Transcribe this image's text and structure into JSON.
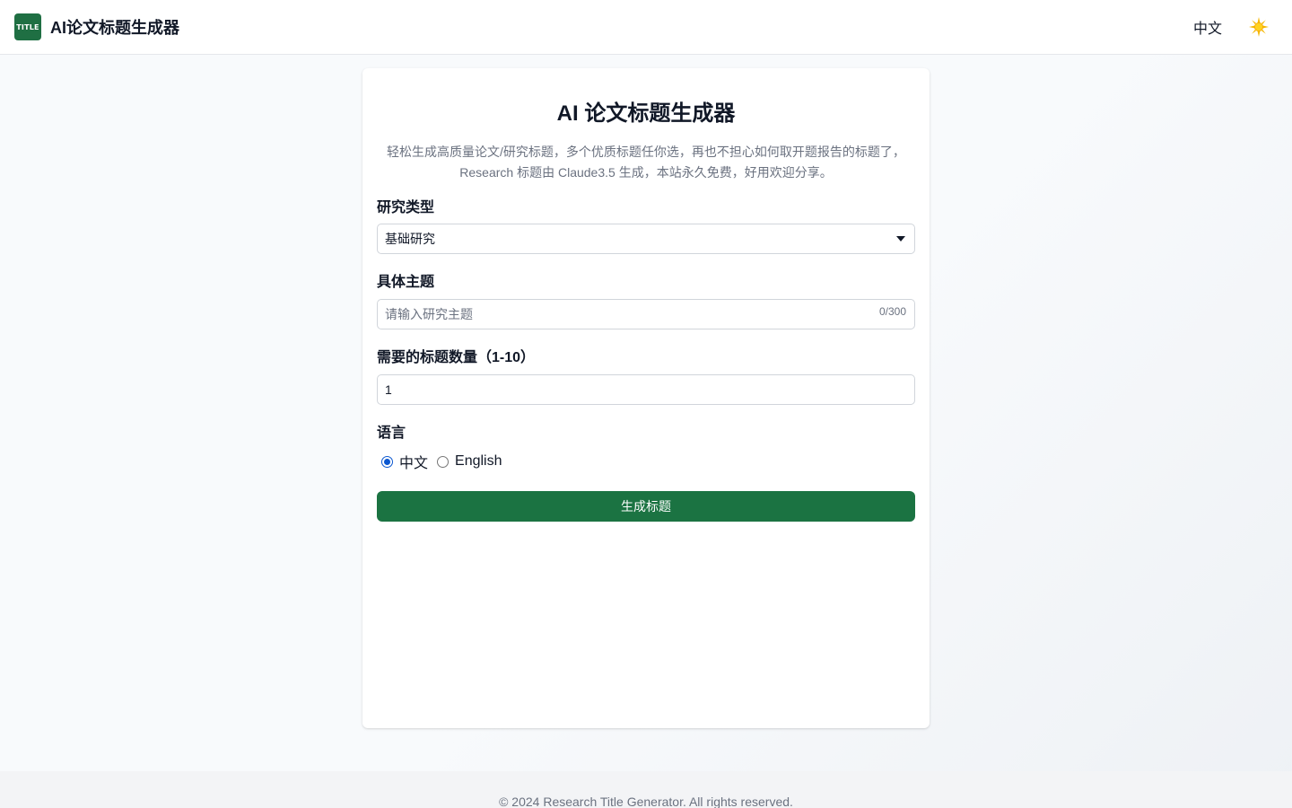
{
  "header": {
    "logo_text": "TITLE",
    "brand_title": "AI论文标题生成器",
    "language_switch": "中文",
    "theme_icon": "sun-icon"
  },
  "card": {
    "title": "AI 论文标题生成器",
    "description_line1": "轻松生成高质量论文/研究标题，多个优质标题任你选，再也不担心如何取开题报告的标题了，",
    "description_line2": "Research 标题由 Claude3.5 生成，本站永久免费，好用欢迎分享。",
    "research_type": {
      "label": "研究类型",
      "selected": "基础研究"
    },
    "topic": {
      "label": "具体主题",
      "placeholder": "请输入研究主题",
      "value": "",
      "char_count": "0/300"
    },
    "title_count": {
      "label": "需要的标题数量（1-10）",
      "value": "1"
    },
    "language": {
      "label": "语言",
      "options": [
        {
          "label": "中文",
          "checked": true
        },
        {
          "label": "English",
          "checked": false
        }
      ]
    },
    "submit_label": "生成标题"
  },
  "footer": {
    "copyright": "© 2024 Research Title Generator. All rights reserved."
  },
  "colors": {
    "brand_green": "#1b7342",
    "radio_blue": "#0b57d0"
  }
}
